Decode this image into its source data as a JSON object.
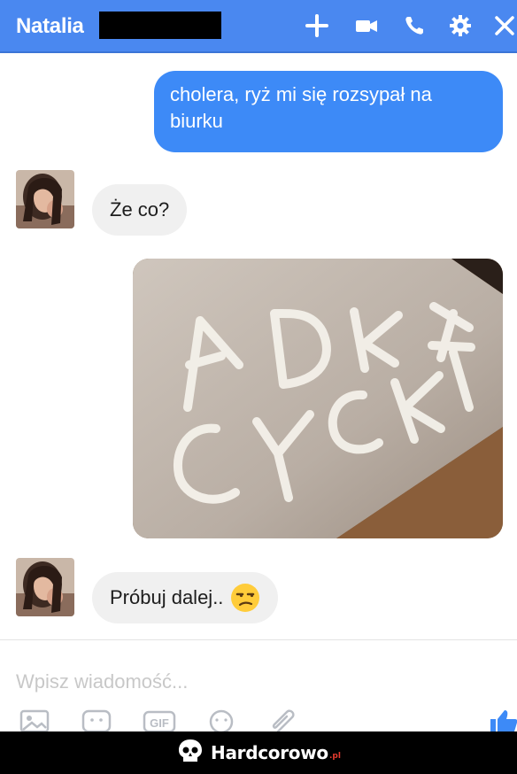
{
  "header": {
    "contact_name": "Natalia",
    "background": "#4a88f0",
    "icons": [
      "plus-icon",
      "video-camera-icon",
      "phone-icon",
      "gear-icon",
      "close-icon"
    ]
  },
  "messages": [
    {
      "direction": "outgoing",
      "text": "cholera, ryż mi się rozsypał na biurku",
      "color": "#3d8af7"
    },
    {
      "direction": "incoming",
      "text": "Że co?"
    },
    {
      "direction": "outgoing",
      "type": "photo",
      "photo_text": [
        "ADKA",
        "CYCKI"
      ]
    },
    {
      "direction": "incoming",
      "text": "Próbuj dalej..",
      "emoji": "unamused-face-icon"
    }
  ],
  "composer": {
    "placeholder": "Wpisz wiadomość...",
    "tools": [
      "image-icon",
      "sticker-icon",
      "gif-icon",
      "emoji-icon",
      "attachment-icon",
      "like-icon"
    ],
    "gif_label": "GIF"
  },
  "watermark": {
    "text": "Hardcorowo",
    "suffix": ".pl"
  }
}
